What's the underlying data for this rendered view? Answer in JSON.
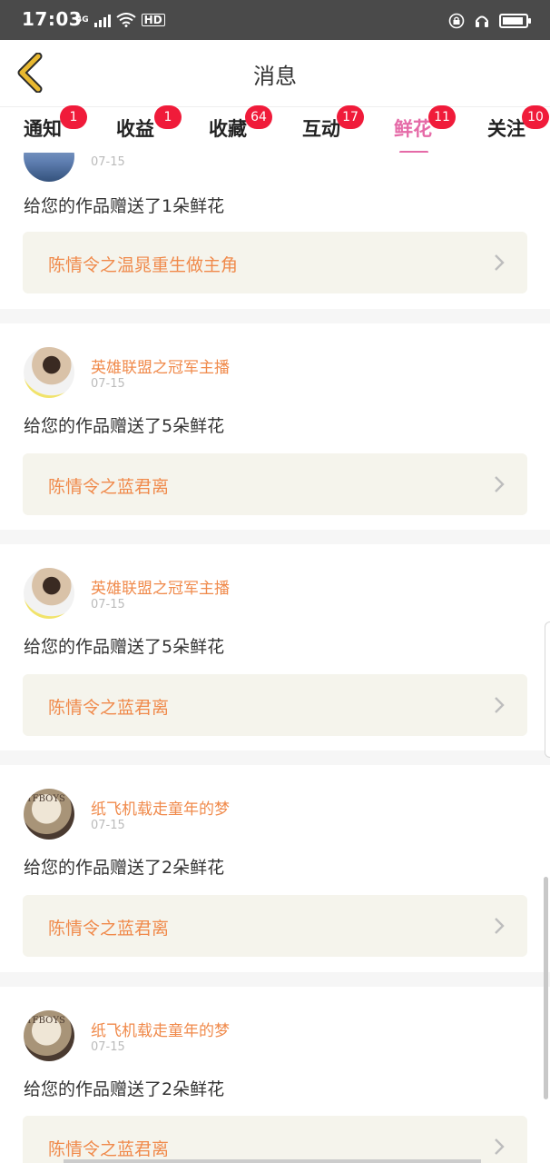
{
  "status_bar": {
    "time": "17:03",
    "network": "4G",
    "hd": "HD"
  },
  "header": {
    "title": "消息"
  },
  "tabs": [
    {
      "label": "通知",
      "badge": "1",
      "active": false
    },
    {
      "label": "收益",
      "badge": "1",
      "active": false
    },
    {
      "label": "收藏",
      "badge": "64",
      "active": false
    },
    {
      "label": "互动",
      "badge": "17",
      "active": false
    },
    {
      "label": "鲜花",
      "badge": "11",
      "active": true
    },
    {
      "label": "关注",
      "badge": "10",
      "active": false
    }
  ],
  "feed": [
    {
      "sender": "",
      "date": "07-15",
      "message": "给您的作品赠送了1朵鲜花",
      "work": "陈情令之温晁重生做主角"
    },
    {
      "sender": "英雄联盟之冠军主播",
      "date": "07-15",
      "message": "给您的作品赠送了5朵鲜花",
      "work": "陈情令之蓝君离"
    },
    {
      "sender": "英雄联盟之冠军主播",
      "date": "07-15",
      "message": "给您的作品赠送了5朵鲜花",
      "work": "陈情令之蓝君离"
    },
    {
      "sender": "纸飞机载走童年的梦",
      "date": "07-15",
      "message": "给您的作品赠送了2朵鲜花",
      "work": "陈情令之蓝君离"
    },
    {
      "sender": "纸飞机载走童年的梦",
      "date": "07-15",
      "message": "给您的作品赠送了2朵鲜花",
      "work": "陈情令之蓝君离"
    }
  ],
  "avatar_text": "TFBOYS",
  "colors": {
    "accent_pink": "#e56aa7",
    "badge_red": "#f01b3a",
    "sender_orange": "#f08a4b",
    "card_bg": "#f5f4ec",
    "back_arrow": "#e9b930"
  }
}
